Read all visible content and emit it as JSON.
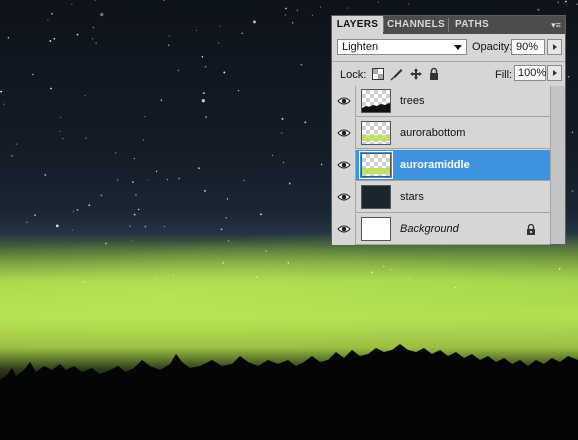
{
  "panel": {
    "tabs": [
      {
        "label": "LAYERS",
        "active": true
      },
      {
        "label": "CHANNELS",
        "active": false
      },
      {
        "label": "PATHS",
        "active": false
      }
    ],
    "menu_icon": "panel-menu-icon",
    "blend_mode": "Lighten",
    "opacity_label": "Opacity:",
    "opacity_value": "90%",
    "lock_label": "Lock:",
    "lock_icons": [
      "lock-transparent-pixels-icon",
      "lock-image-pixels-icon",
      "lock-position-icon",
      "lock-all-icon"
    ],
    "fill_label": "Fill:",
    "fill_value": "100%",
    "layers": [
      {
        "name": "trees",
        "visible": true,
        "selected": false,
        "thumbnail": "checker-with-dark-trees"
      },
      {
        "name": "aurorabottom",
        "visible": true,
        "selected": false,
        "thumbnail": "checker-with-green-band"
      },
      {
        "name": "auroramiddle",
        "visible": true,
        "selected": true,
        "thumbnail": "checker-with-green-band"
      },
      {
        "name": "stars",
        "visible": true,
        "selected": false,
        "thumbnail": "dark-starfield"
      },
      {
        "name": "Background",
        "visible": true,
        "selected": false,
        "italic": true,
        "locked": true,
        "thumbnail": "white"
      }
    ]
  },
  "colors": {
    "selection": "#3d93e0",
    "panel_bg": "#d6d6d6",
    "tab_bar": "#4c4c4c",
    "aurora_green": "#b5e052",
    "sky": "#141c27"
  }
}
